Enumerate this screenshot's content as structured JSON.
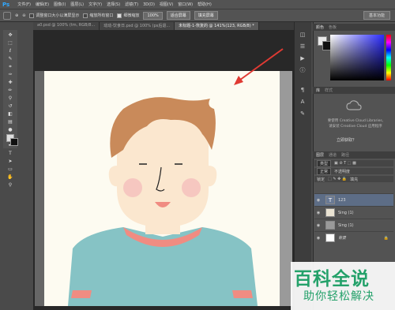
{
  "menubar": {
    "app_logo": "Ps",
    "items": [
      "文件(F)",
      "编辑(E)",
      "图像(I)",
      "图层(L)",
      "文字(Y)",
      "选择(S)",
      "滤镜(T)",
      "3D(D)",
      "视图(V)",
      "窗口(W)",
      "帮助(H)"
    ]
  },
  "options_bar": {
    "resize_windows_label": "调整窗口大小以满屏显示",
    "zoom_all_label": "缩放所有窗口",
    "scrubby_zoom_label": "细微缩放",
    "percent_button": "100%",
    "fit_screen_button": "适合屏幕",
    "fill_screen_button": "填充屏幕",
    "workspace_button": "基本功能"
  },
  "doc_tabs": [
    {
      "label": "a0.psd @ 100% (tm, RGB/8...",
      "active": false
    },
    {
      "label": "动动-饮食日.psd @ 100% (ps后退...",
      "active": false
    },
    {
      "label": "未标题-1-恢复的 @ 141%(123, RGB/8) *",
      "active": true
    }
  ],
  "panels": {
    "color_tab": "颜色",
    "swatches_tab": "色板",
    "libraries_tab": "库",
    "adjust_tab": "样式",
    "cc_text_line1": "要使用 Creative Cloud Libraries,",
    "cc_text_line2": "请安装 Creative Cloud 应用程序",
    "learn_label": "立即获取？",
    "layers_tab": "图层",
    "channels_tab": "通道",
    "paths_tab": "路径",
    "kind_label": "类型",
    "blend_mode": "正常",
    "opacity_label": "不透明度",
    "lock_label": "锁定",
    "fill_label": "填充"
  },
  "layers": [
    {
      "name": "123",
      "selected": true,
      "type": "text"
    },
    {
      "name": "Sing (1)",
      "selected": false,
      "type": "image"
    },
    {
      "name": "Sing (1)",
      "selected": false,
      "type": "image"
    },
    {
      "name": "背景",
      "selected": false,
      "type": "background"
    }
  ],
  "canvas": {
    "background_color": "#fdfbf1",
    "hair_color": "#c98a5a",
    "skin_color": "#fbe7cf",
    "shirt_color": "#86c3c5",
    "accent_color": "#f08c82"
  },
  "annotation": {
    "arrow_color": "#e03a33"
  },
  "watermark": {
    "title": "百科全说",
    "subtitle": "助你轻松解决"
  }
}
